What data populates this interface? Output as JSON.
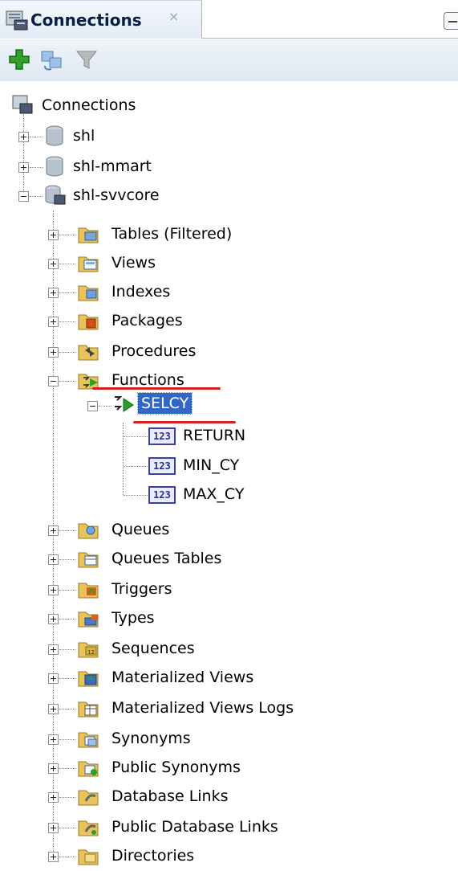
{
  "panel": {
    "tab_title": "Connections",
    "tab_close": "×"
  },
  "tree": {
    "root": "Connections",
    "connections": [
      {
        "label": "shl",
        "expanded": false
      },
      {
        "label": "shl-mmart",
        "expanded": false
      },
      {
        "label": "shl-svvcore",
        "expanded": true
      }
    ],
    "categories": [
      "Tables (Filtered)",
      "Views",
      "Indexes",
      "Packages",
      "Procedures",
      "Functions",
      "Queues",
      "Queues Tables",
      "Triggers",
      "Types",
      "Sequences",
      "Materialized Views",
      "Materialized Views Logs",
      "Synonyms",
      "Public Synonyms",
      "Database Links",
      "Public Database Links",
      "Directories"
    ],
    "function": {
      "name": "SELCY",
      "params": [
        "RETURN",
        "MIN_CY",
        "MAX_CY"
      ],
      "param_badge": "123"
    }
  },
  "colors": {
    "selection": "#3168c6",
    "annotation_underline": "#d42020",
    "folder": "#e8c35a"
  }
}
